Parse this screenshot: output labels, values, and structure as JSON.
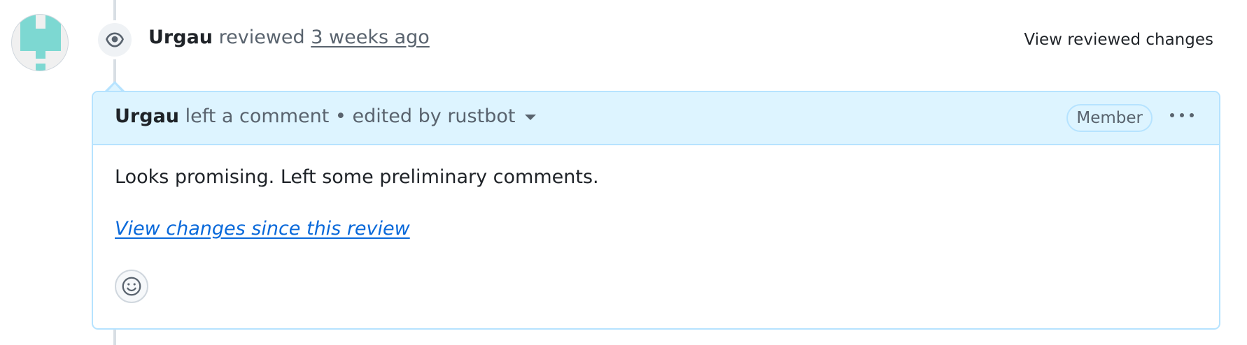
{
  "review": {
    "author": "Urgau",
    "action": "reviewed",
    "time": "3 weeks ago",
    "view_reviewed_label": "View reviewed changes"
  },
  "comment": {
    "author": "Urgau",
    "action": "left a comment",
    "separator": "•",
    "edited_by": "edited by rustbot",
    "badge": "Member",
    "body": "Looks promising. Left some preliminary comments.",
    "link": "View changes since this review"
  },
  "icons": {
    "review": "eye-icon",
    "more": "kebab-horizontal-icon",
    "reaction": "smiley-icon",
    "dropdown": "triangle-down-icon"
  },
  "colors": {
    "header_bg": "#ddf4ff",
    "border": "#b6e3ff",
    "link": "#0969da",
    "avatar_teal": "#7dd8d2"
  }
}
